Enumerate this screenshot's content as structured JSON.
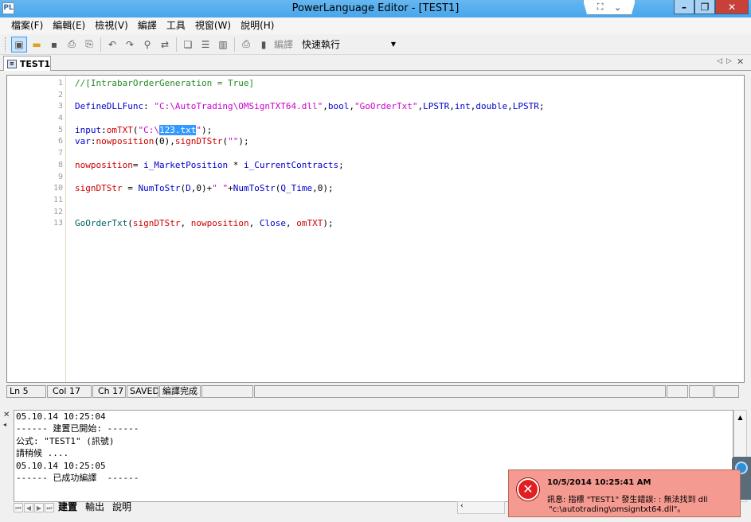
{
  "window": {
    "title": "PowerLanguage Editor - [TEST1]"
  },
  "menu": [
    "檔案(F)",
    "編輯(E)",
    "檢視(V)",
    "編譯",
    "工具",
    "視窗(W)",
    "說明(H)"
  ],
  "toolbar": {
    "compile_label": "編譯",
    "quick_exec": "快速執行"
  },
  "doc_tab": {
    "label": "TEST1"
  },
  "editor": {
    "lines": [
      {
        "n": "1",
        "tokens": [
          {
            "c": "com",
            "t": "//[IntrabarOrderGeneration = True]"
          }
        ]
      },
      {
        "n": "2",
        "tokens": []
      },
      {
        "n": "3",
        "tokens": [
          {
            "c": "kw",
            "t": "DefineDLLFunc"
          },
          {
            "c": "pun",
            "t": ": "
          },
          {
            "c": "str",
            "t": "\"C:\\AutoTrading\\OMSignTXT64.dll\""
          },
          {
            "c": "pun",
            "t": ","
          },
          {
            "c": "kw",
            "t": "bool"
          },
          {
            "c": "pun",
            "t": ","
          },
          {
            "c": "str",
            "t": "\"GoOrderTxt\""
          },
          {
            "c": "pun",
            "t": ","
          },
          {
            "c": "kw",
            "t": "LPSTR"
          },
          {
            "c": "pun",
            "t": ","
          },
          {
            "c": "kw",
            "t": "int"
          },
          {
            "c": "pun",
            "t": ","
          },
          {
            "c": "kw",
            "t": "double"
          },
          {
            "c": "pun",
            "t": ","
          },
          {
            "c": "kw",
            "t": "LPSTR"
          },
          {
            "c": "pun",
            "t": ";"
          }
        ]
      },
      {
        "n": "4",
        "tokens": []
      },
      {
        "n": "5",
        "tokens": [
          {
            "c": "kw",
            "t": "input"
          },
          {
            "c": "pun",
            "t": ":"
          },
          {
            "c": "id",
            "t": "omTXT"
          },
          {
            "c": "pun",
            "t": "("
          },
          {
            "c": "str",
            "t": "\"C:\\"
          },
          {
            "c": "sel",
            "t": "123.txt"
          },
          {
            "c": "str",
            "t": "\""
          },
          {
            "c": "pun",
            "t": ");"
          }
        ]
      },
      {
        "n": "6",
        "tokens": [
          {
            "c": "kw",
            "t": "var"
          },
          {
            "c": "pun",
            "t": ":"
          },
          {
            "c": "id",
            "t": "nowposition"
          },
          {
            "c": "pun",
            "t": "(0),"
          },
          {
            "c": "id",
            "t": "signDTStr"
          },
          {
            "c": "pun",
            "t": "("
          },
          {
            "c": "str",
            "t": "\"\""
          },
          {
            "c": "pun",
            "t": ");"
          }
        ]
      },
      {
        "n": "7",
        "tokens": []
      },
      {
        "n": "8",
        "tokens": [
          {
            "c": "id",
            "t": "nowposition"
          },
          {
            "c": "pun",
            "t": "= "
          },
          {
            "c": "kw",
            "t": "i_MarketPosition"
          },
          {
            "c": "pun",
            "t": " * "
          },
          {
            "c": "kw",
            "t": "i_CurrentContracts"
          },
          {
            "c": "pun",
            "t": ";"
          }
        ]
      },
      {
        "n": "9",
        "tokens": []
      },
      {
        "n": "10",
        "tokens": [
          {
            "c": "id",
            "t": "signDTStr"
          },
          {
            "c": "pun",
            "t": " = "
          },
          {
            "c": "kw",
            "t": "NumToStr"
          },
          {
            "c": "pun",
            "t": "("
          },
          {
            "c": "kw",
            "t": "D"
          },
          {
            "c": "pun",
            "t": ",0)+"
          },
          {
            "c": "str",
            "t": "\" \""
          },
          {
            "c": "pun",
            "t": "+"
          },
          {
            "c": "kw",
            "t": "NumToStr"
          },
          {
            "c": "pun",
            "t": "("
          },
          {
            "c": "kw",
            "t": "Q_Time"
          },
          {
            "c": "pun",
            "t": ",0);"
          }
        ]
      },
      {
        "n": "11",
        "tokens": []
      },
      {
        "n": "12",
        "tokens": []
      },
      {
        "n": "13",
        "tokens": [
          {
            "c": "txt",
            "t": "GoOrderTxt"
          },
          {
            "c": "pun",
            "t": "("
          },
          {
            "c": "id",
            "t": "signDTStr"
          },
          {
            "c": "pun",
            "t": ", "
          },
          {
            "c": "id",
            "t": "nowposition"
          },
          {
            "c": "pun",
            "t": ", "
          },
          {
            "c": "kw",
            "t": "Close"
          },
          {
            "c": "pun",
            "t": ", "
          },
          {
            "c": "id",
            "t": "omTXT"
          },
          {
            "c": "pun",
            "t": ");"
          }
        ]
      }
    ]
  },
  "status": {
    "ln": "Ln 5",
    "col": "Col 17",
    "ch": "Ch 17",
    "saved": "SAVED",
    "compiled": "編譯完成"
  },
  "output": {
    "lines": [
      "05.10.14 10:25:04",
      "------ 建置已開始: ------",
      "公式: \"TEST1\" (訊號)",
      "請稍候 ....",
      "05.10.14 10:25:05",
      "------ 已成功編譯  ------"
    ],
    "tabs": [
      "建置",
      "輸出",
      "說明"
    ]
  },
  "notification": {
    "time": "10/5/2014 10:25:41 AM",
    "message_line1": "訊息: 指標 \"TEST1\" 發生錯誤: : 無法找到 dll",
    "message_line2": "\"c:\\autotrading\\omsigntxt64.dll\"。"
  }
}
